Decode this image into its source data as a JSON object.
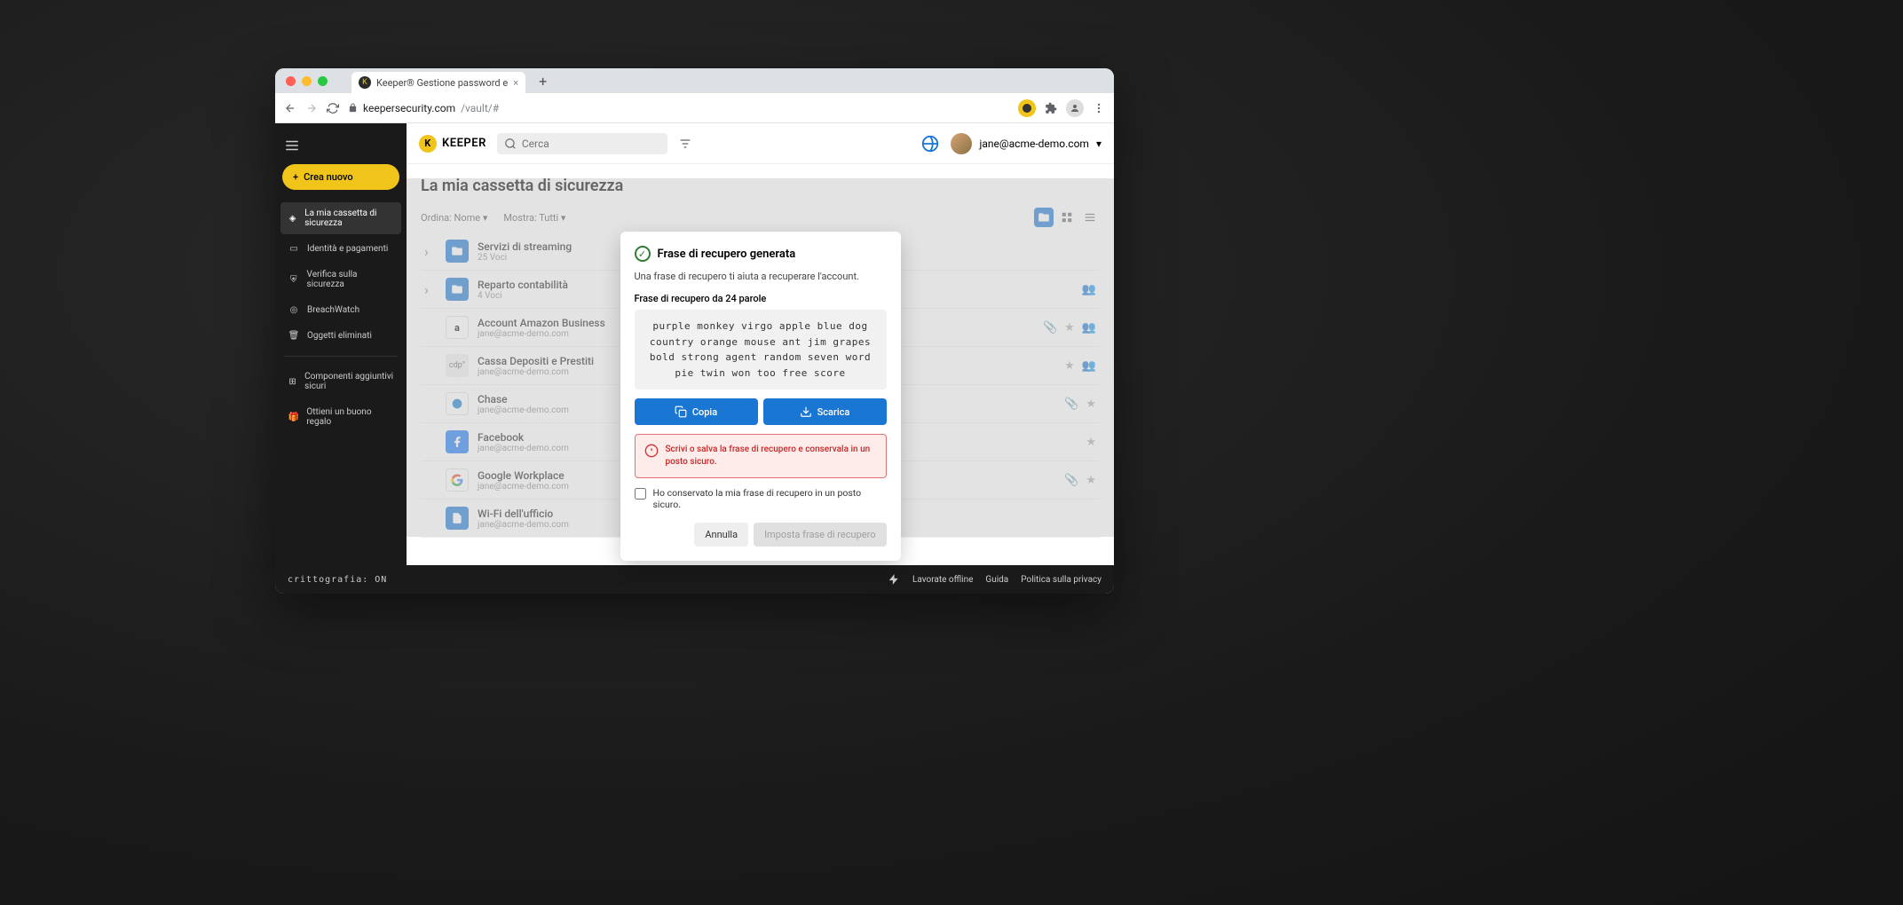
{
  "browser": {
    "tab_title": "Keeper® Gestione password e",
    "url_domain": "keepersecurity.com",
    "url_path": "/vault/#"
  },
  "topbar": {
    "logo_text": "KEEPER",
    "search_placeholder": "Cerca",
    "user_email": "jane@acme-demo.com"
  },
  "sidebar": {
    "create_label": "Crea nuovo",
    "items": [
      "La mia cassetta di sicurezza",
      "Identità e pagamenti",
      "Verifica sulla sicurezza",
      "BreachWatch",
      "Oggetti eliminati"
    ],
    "secondary": [
      "Componenti aggiuntivi sicuri",
      "Ottieni un buono regalo"
    ]
  },
  "page": {
    "title": "La mia cassetta di sicurezza",
    "sort_label": "Ordina: Nome",
    "show_label": "Mostra: Tutti"
  },
  "records": [
    {
      "title": "Servizi di streaming",
      "sub": "25 Voci",
      "type": "folder",
      "chev": true
    },
    {
      "title": "Reparto contabilità",
      "sub": "4 Voci",
      "type": "folder",
      "chev": true,
      "share": true
    },
    {
      "title": "Account Amazon Business",
      "sub": "jane@acme-demo.com",
      "type": "amazon",
      "clip": true,
      "star": true,
      "share": true
    },
    {
      "title": "Cassa Depositi e Prestiti",
      "sub": "jane@acme-demo.com",
      "type": "gray",
      "label": "cdp",
      "star": true,
      "share": true
    },
    {
      "title": "Chase",
      "sub": "jane@acme-demo.com",
      "type": "chase",
      "clip": true,
      "star": true
    },
    {
      "title": "Facebook",
      "sub": "jane@acme-demo.com",
      "type": "fb",
      "star": true
    },
    {
      "title": "Google Workplace",
      "sub": "jane@acme-demo.com",
      "type": "google",
      "clip": true,
      "star": true
    },
    {
      "title": "Wi-Fi dell'ufficio",
      "sub": "jane@acme-demo.com",
      "type": "wifi"
    }
  ],
  "modal": {
    "title": "Frase di recupero generata",
    "desc": "Una frase di recupero ti aiuta a recuperare l'account.",
    "phrase_label": "Frase di recupero da 24 parole",
    "phrase": "purple monkey virgo apple blue dog country orange mouse ant jim grapes bold strong agent random seven word pie twin won too free score",
    "copy": "Copia",
    "download": "Scarica",
    "warning": "Scrivi o salva la frase di recupero e conservala in un posto sicuro.",
    "checkbox_label": "Ho conservato la mia frase di recupero in un posto sicuro.",
    "cancel": "Annulla",
    "confirm": "Imposta frase di recupero"
  },
  "footer": {
    "crypto": "crittografia: ON",
    "offline": "Lavorate offline",
    "help": "Guida",
    "privacy": "Politica sulla privacy"
  }
}
